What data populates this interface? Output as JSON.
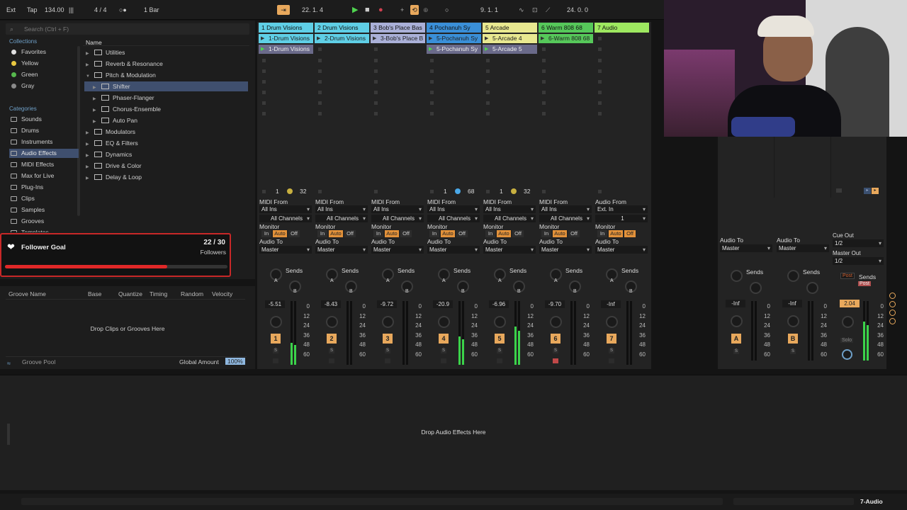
{
  "toolbar": {
    "ext": "Ext",
    "tap": "Tap",
    "tempo": "134.00",
    "meter_icon": "|||",
    "sig": "4 / 4",
    "metro": "○●",
    "quant": "1 Bar",
    "position": "22.   1.   4",
    "loop_start": "9.   1.   1",
    "loop_len": "24.   0.   0",
    "play_icon": "▶",
    "stop_icon": "■",
    "rec_icon": "●"
  },
  "browser": {
    "search_placeholder": "Search (Ctrl + F)",
    "collections_header": "Collections",
    "categories_header": "Categories",
    "name_col": "Name",
    "collections": [
      {
        "label": "Favorites",
        "color": "#e0e0e0"
      },
      {
        "label": "Yellow",
        "color": "#e8c740"
      },
      {
        "label": "Green",
        "color": "#56b84d"
      },
      {
        "label": "Gray",
        "color": "#8a8a8a"
      }
    ],
    "categories": [
      "Sounds",
      "Drums",
      "Instruments",
      "Audio Effects",
      "MIDI Effects",
      "Max for Live",
      "Plug-Ins",
      "Clips",
      "Samples",
      "Grooves",
      "Templates"
    ],
    "tree": [
      "Utilities",
      "Reverb & Resonance",
      "Pitch & Modulation",
      "Shifter",
      "Phaser-Flanger",
      "Chorus-Ensemble",
      "Auto Pan",
      "Modulators",
      "EQ & Filters",
      "Dynamics",
      "Drive & Color",
      "Delay & Loop"
    ]
  },
  "follower": {
    "label": "Follower Goal",
    "count": "22 / 30",
    "unit": "Followers",
    "progress": 0.73
  },
  "groove": {
    "cols": [
      "Groove Name",
      "Base",
      "Quantize",
      "Timing",
      "Random",
      "Velocity"
    ],
    "drop": "Drop Clips or Grooves Here",
    "pool": "Groove Pool",
    "global_label": "Global Amount",
    "global_val": "100%"
  },
  "tracks": [
    {
      "name": "1 Drum Visions",
      "color": "#5fcfe6",
      "clips": [
        "1-Drum Visions",
        "1-Drum Visions"
      ],
      "clip_color": "#5fcfe6",
      "input": "MIDI From",
      "src": "All Ins",
      "ch": "All Channels",
      "vol": "-5.51",
      "num": "1",
      "meter": 0.35
    },
    {
      "name": "2 Drum Visions",
      "color": "#5fcfe6",
      "clips": [
        "2-Drum Visions",
        ""
      ],
      "clip_color": "#5fcfe6",
      "input": "MIDI From",
      "src": "All Ins",
      "ch": "All Channels",
      "vol": "-8.43",
      "num": "2",
      "meter": 0
    },
    {
      "name": "3 Bob's Place Bas",
      "color": "#aab0d8",
      "clips": [
        "3-Bob's Place B",
        ""
      ],
      "clip_color": "#aab0d8",
      "input": "MIDI From",
      "src": "All Ins",
      "ch": "All Channels",
      "vol": "-9.72",
      "num": "3",
      "meter": 0
    },
    {
      "name": "4 Pochanuh Sy",
      "color": "#3a8fd8",
      "clips": [
        "5-Pochanuh Sy",
        "5-Pochanuh Sy"
      ],
      "clip_color": "#3a8fd8",
      "input": "MIDI From",
      "src": "All Ins",
      "ch": "All Channels",
      "vol": "-20.9",
      "num": "4",
      "meter": 0.45
    },
    {
      "name": "5 Arcade",
      "color": "#e8e890",
      "clips": [
        "5-Arcade 4",
        "5-Arcade 5"
      ],
      "clip_color": "#e8e890",
      "input": "MIDI From",
      "src": "All Ins",
      "ch": "All Channels",
      "vol": "-6.96",
      "num": "5",
      "meter": 0.6
    },
    {
      "name": "6 Warm 808 68",
      "color": "#56c85a",
      "clips": [
        "6-Warm 808 68",
        ""
      ],
      "clip_color": "#56c85a",
      "input": "MIDI From",
      "src": "All Ins",
      "ch": "All Channels",
      "vol": "-9.70",
      "num": "6",
      "meter": 0
    },
    {
      "name": "7 Audio",
      "color": "#9ee860",
      "clips": [
        "",
        ""
      ],
      "clip_color": "#9ee860",
      "input": "Audio From",
      "src": "Ext. In",
      "ch": "1",
      "vol": "-Inf",
      "num": "7",
      "meter": 0
    }
  ],
  "track_labels": {
    "monitor": "Monitor",
    "in": "In",
    "auto": "Auto",
    "off": "Off",
    "audio_to": "Audio To",
    "master": "Master",
    "sends": "Sends",
    "a": "A",
    "b": "B",
    "s": "S",
    "db": [
      "0",
      "12",
      "24",
      "36",
      "48",
      "60"
    ]
  },
  "scene_counts": [
    {
      "a": "1",
      "b": "32"
    },
    {
      "a": "1",
      "b": "68"
    },
    {
      "a": "1",
      "b": "32"
    }
  ],
  "returns": [
    {
      "label": "A",
      "vol": "-Inf"
    },
    {
      "label": "B",
      "vol": "-Inf"
    }
  ],
  "master": {
    "cue_out": "Cue Out",
    "cue_val": "1/2",
    "master_out": "Master Out",
    "master_val": "1/2",
    "vol": "2.04",
    "post": "Post",
    "solo": "Solo"
  },
  "devices": {
    "drop": "Drop Audio Effects Here"
  },
  "status": {
    "track": "7-Audio"
  }
}
